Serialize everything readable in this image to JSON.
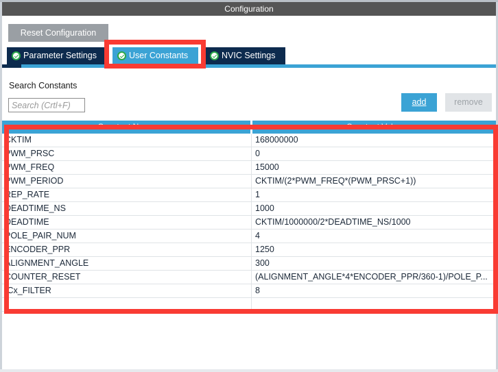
{
  "window": {
    "title": "Configuration"
  },
  "toolbar": {
    "reset_label": "Reset Configuration"
  },
  "tabs": [
    {
      "label": "Parameter Settings",
      "icon": "check-circle-icon",
      "active": false
    },
    {
      "label": "User Constants",
      "icon": "check-circle-icon",
      "active": true
    },
    {
      "label": "NVIC Settings",
      "icon": "check-circle-icon",
      "active": false
    }
  ],
  "search": {
    "label": "Search Constants",
    "value": "",
    "placeholder": "Search (Crtl+F)"
  },
  "actions": {
    "add_label": "add",
    "remove_label": "remove"
  },
  "table": {
    "columns": [
      "Constant Name",
      "Constant Value"
    ],
    "rows": [
      {
        "name": "CKTIM",
        "value": "168000000"
      },
      {
        "name": "PWM_PRSC",
        "value": "0"
      },
      {
        "name": "PWM_FREQ",
        "value": "15000"
      },
      {
        "name": "PWM_PERIOD",
        "value": "CKTIM/(2*PWM_FREQ*(PWM_PRSC+1))"
      },
      {
        "name": "REP_RATE",
        "value": "1"
      },
      {
        "name": "DEADTIME_NS",
        "value": "1000"
      },
      {
        "name": "DEADTIME",
        "value": "CKTIM/1000000/2*DEADTIME_NS/1000"
      },
      {
        "name": "POLE_PAIR_NUM",
        "value": "4"
      },
      {
        "name": "ENCODER_PPR",
        "value": "1250"
      },
      {
        "name": "ALIGNMENT_ANGLE",
        "value": "300"
      },
      {
        "name": "COUNTER_RESET",
        "value": "(ALIGNMENT_ANGLE*4*ENCODER_PPR/360-1)/POLE_P..."
      },
      {
        "name": "ICx_FILTER",
        "value": "8"
      }
    ]
  },
  "colors": {
    "title_bar": "#555555",
    "tab_inactive": "#0d2b4e",
    "tab_active": "#3ba3d5",
    "accent": "#3ba3d5",
    "annotation": "#f93b33",
    "reset_button": "#9a9fa4",
    "remove_disabled": "#e1e4e7"
  }
}
